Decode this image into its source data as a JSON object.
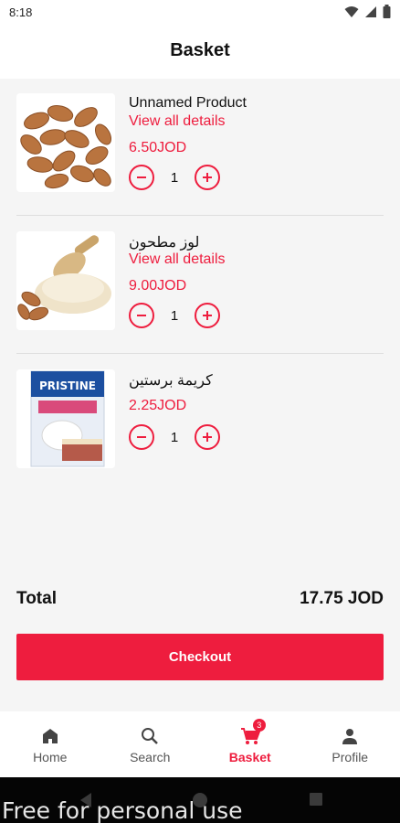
{
  "status_bar": {
    "time": "8:18"
  },
  "header": {
    "title": "Basket"
  },
  "items": [
    {
      "name": "Unnamed Product",
      "details_link": "View all details",
      "price": "6.50JOD",
      "quantity": "1",
      "image_icon": "almonds-image"
    },
    {
      "name": "لوز مطحون",
      "details_link": "View all details",
      "price": "9.00JOD",
      "quantity": "1",
      "image_icon": "ground-almond-image"
    },
    {
      "name": "كريمة برستين",
      "price": "2.25JOD",
      "quantity": "1",
      "image_icon": "pristine-cream-box-image"
    }
  ],
  "summary": {
    "total_label": "Total",
    "total_value": "17.75 JOD"
  },
  "checkout": {
    "label": "Checkout"
  },
  "bottom_nav": {
    "items": [
      {
        "label": "Home",
        "icon": "home-icon"
      },
      {
        "label": "Search",
        "icon": "search-icon"
      },
      {
        "label": "Basket",
        "icon": "cart-icon",
        "badge": "3",
        "active": true
      },
      {
        "label": "Profile",
        "icon": "person-icon"
      }
    ]
  },
  "watermark": {
    "text": "Free for personal use"
  },
  "colors": {
    "accent": "#ee1d3e",
    "background": "#f5f5f5",
    "surface": "#ffffff"
  }
}
